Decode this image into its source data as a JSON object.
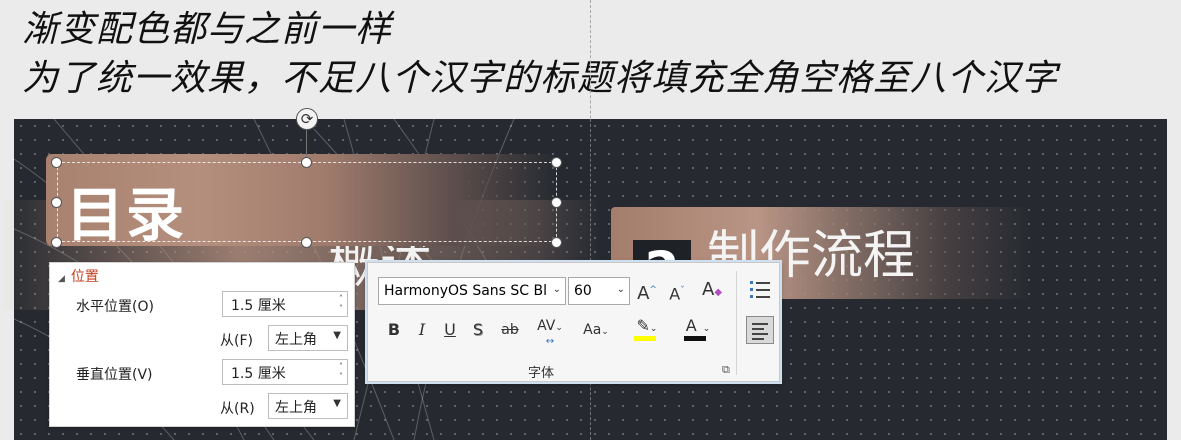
{
  "caption": {
    "line1": "渐变配色都与之前一样",
    "line2": "为了统一效果，不足八个汉字的标题将填充全角空格至八个汉字"
  },
  "slide": {
    "title": "目录",
    "item1_text": "概述",
    "item2_number": "2",
    "item2_text": "制作流程"
  },
  "position_panel": {
    "header": "位置",
    "horizontal_label": "水平位置(O)",
    "horizontal_value": "1.5 厘米",
    "horizontal_from_label": "从(F)",
    "horizontal_from_value": "左上角",
    "vertical_label": "垂直位置(V)",
    "vertical_value": "1.5 厘米",
    "vertical_from_label": "从(R)",
    "vertical_from_value": "左上角"
  },
  "font_toolbar": {
    "font_name": "HarmonyOS Sans SC Bla",
    "font_size": "60",
    "group_label": "字体",
    "highlight_color": "#ffff00",
    "font_color": "#111111",
    "accent_color": "#c43e1c"
  }
}
